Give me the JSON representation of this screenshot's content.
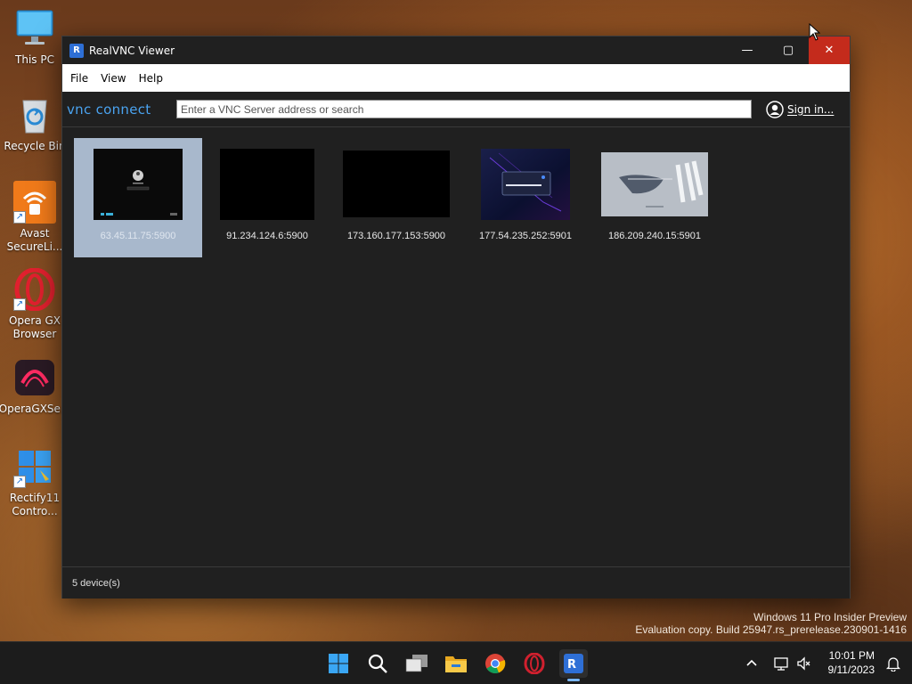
{
  "desktop": {
    "icons": [
      {
        "label": "This PC"
      },
      {
        "label": "Recycle Bin"
      },
      {
        "label": "Avast SecureLi..."
      },
      {
        "label": "Opera GX Browser"
      },
      {
        "label": "OperaGXSe..."
      },
      {
        "label": "Rectify11 Contro..."
      }
    ]
  },
  "window": {
    "title": "RealVNC Viewer",
    "minimize_glyph": "—",
    "maximize_glyph": "▢",
    "close_glyph": "✕"
  },
  "menu": {
    "items": [
      {
        "label": "File"
      },
      {
        "label": "View"
      },
      {
        "label": "Help"
      }
    ]
  },
  "toolbar": {
    "brand": "vnc connect",
    "search_placeholder": "Enter a VNC Server address or search",
    "search_value": "",
    "signin_label": "Sign in..."
  },
  "devices": [
    {
      "address": "63.45.11.75:5900",
      "selected": true
    },
    {
      "address": "91.234.124.6:5900",
      "selected": false
    },
    {
      "address": "173.160.177.153:5900",
      "selected": false
    },
    {
      "address": "177.54.235.252:5901",
      "selected": false
    },
    {
      "address": "186.209.240.15:5901",
      "selected": false
    }
  ],
  "status": {
    "device_count": "5 device(s)"
  },
  "watermark": {
    "line1": "Windows 11 Pro Insider Preview",
    "line2": "Evaluation copy. Build 25947.rs_prerelease.230901-1416"
  },
  "taskbar": {
    "icons": [
      "start-icon",
      "search-icon",
      "task-view-icon",
      "file-explorer-icon",
      "chrome-icon",
      "opera-icon",
      "realvnc-icon"
    ],
    "clock_time": "10:01 PM",
    "clock_date": "9/11/2023"
  },
  "colors": {
    "accent": "#2e6fd6",
    "close_button": "#c42b1c",
    "selection": "#a8b8cc",
    "brand_text": "#4aa3f0"
  }
}
